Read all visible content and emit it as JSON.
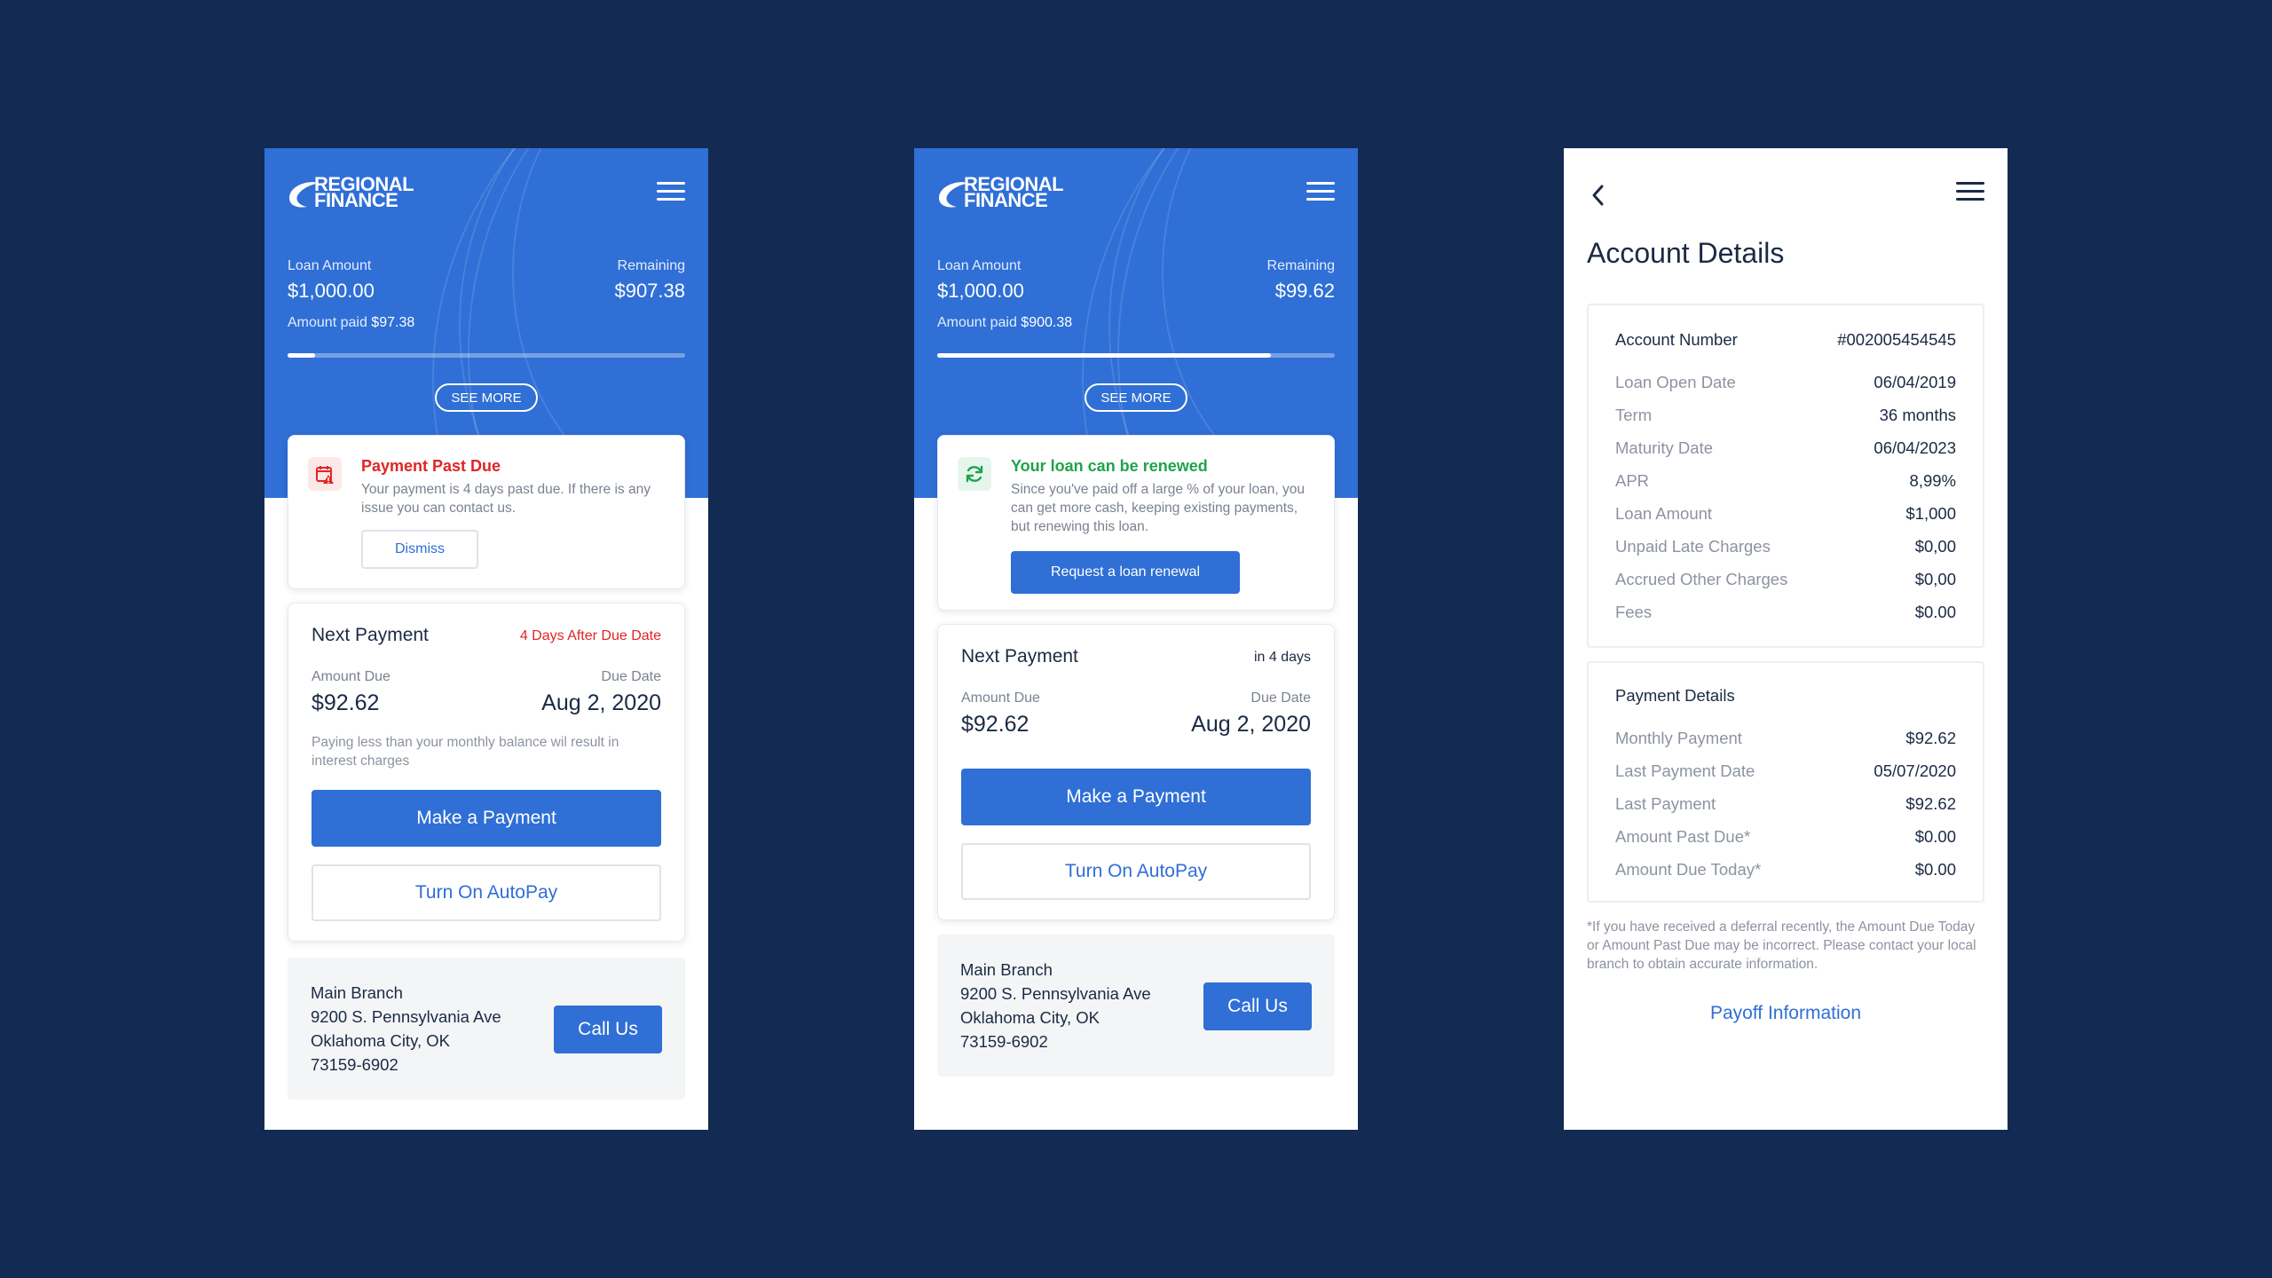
{
  "colors": {
    "background": "#132a52",
    "primary": "#2f6fd6",
    "danger": "#e02424",
    "success": "#1fa34a"
  },
  "logo": {
    "line1": "REGIONAL",
    "line2": "FINANCE"
  },
  "screen1": {
    "loan_amount_label": "Loan Amount",
    "loan_amount": "$1,000.00",
    "remaining_label": "Remaining",
    "remaining": "$907.38",
    "amount_paid_label": "Amount paid",
    "amount_paid": "$97.38",
    "progress_fraction": 0.07,
    "see_more": "SEE MORE",
    "alert": {
      "icon": "calendar-warning-icon",
      "title": "Payment Past Due",
      "text": "Your payment is 4 days past due. If there is any issue you can contact us.",
      "button": "Dismiss"
    },
    "next_payment": {
      "title": "Next Payment",
      "badge": "4 Days After Due Date",
      "amount_due_label": "Amount Due",
      "amount_due": "$92.62",
      "due_date_label": "Due Date",
      "due_date": "Aug 2, 2020",
      "note": "Paying less than your monthly balance wil result in interest charges",
      "make_payment": "Make a Payment",
      "autopay": "Turn On AutoPay"
    },
    "branch": {
      "name": "Main Branch",
      "street": "9200 S. Pennsylvania Ave",
      "city": "Oklahoma City, OK",
      "zip": "73159-6902",
      "call": "Call Us"
    }
  },
  "screen2": {
    "loan_amount_label": "Loan Amount",
    "loan_amount": "$1,000.00",
    "remaining_label": "Remaining",
    "remaining": "$99.62",
    "amount_paid_label": "Amount paid",
    "amount_paid": "$900.38",
    "progress_fraction": 0.84,
    "see_more": "SEE MORE",
    "alert": {
      "icon": "renew-icon",
      "title": "Your loan can be renewed",
      "text": "Since you've paid off a large % of your loan, you can get more cash, keeping existing payments, but renewing this loan.",
      "button": "Request a loan renewal"
    },
    "next_payment": {
      "title": "Next Payment",
      "badge": "in 4 days",
      "amount_due_label": "Amount Due",
      "amount_due": "$92.62",
      "due_date_label": "Due Date",
      "due_date": "Aug 2, 2020",
      "make_payment": "Make a Payment",
      "autopay": "Turn On AutoPay"
    },
    "branch": {
      "name": "Main Branch",
      "street": "9200 S. Pennsylvania Ave",
      "city": "Oklahoma City, OK",
      "zip": "73159-6902",
      "call": "Call Us"
    }
  },
  "screen3": {
    "title": "Account Details",
    "account": {
      "number_label": "Account Number",
      "number": "#002005454545",
      "rows": [
        {
          "label": "Loan Open Date",
          "value": "06/04/2019"
        },
        {
          "label": "Term",
          "value": "36 months"
        },
        {
          "label": "Maturity Date",
          "value": "06/04/2023"
        },
        {
          "label": "APR",
          "value": "8,99%"
        },
        {
          "label": "Loan Amount",
          "value": "$1,000"
        },
        {
          "label": "Unpaid Late Charges",
          "value": "$0,00"
        },
        {
          "label": "Accrued Other Charges",
          "value": "$0,00"
        },
        {
          "label": "Fees",
          "value": "$0.00"
        }
      ]
    },
    "payment": {
      "title": "Payment Details",
      "rows": [
        {
          "label": "Monthly Payment",
          "value": "$92.62"
        },
        {
          "label": "Last Payment Date",
          "value": "05/07/2020"
        },
        {
          "label": "Last Payment",
          "value": "$92.62"
        },
        {
          "label": "Amount Past Due*",
          "value": "$0.00"
        },
        {
          "label": "Amount Due Today*",
          "value": "$0.00"
        }
      ]
    },
    "footnote": "*If you have received a deferral recently, the Amount Due Today or Amount Past Due may be incorrect. Please contact your local branch to obtain accurate information.",
    "payoff": "Payoff Information"
  }
}
